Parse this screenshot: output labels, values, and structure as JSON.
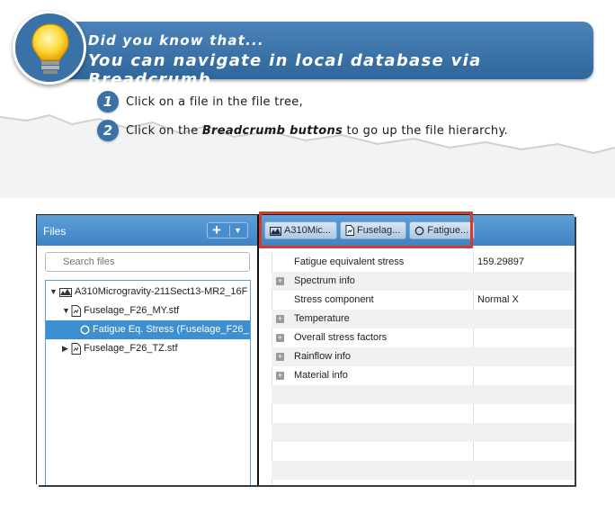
{
  "tip": {
    "line1": "Did you know that...",
    "line2": "You can navigate in local database via Breadcrumb",
    "steps": [
      {
        "num": "1",
        "text": "Click on a file in the file tree,"
      },
      {
        "num": "2",
        "prefix": "Click on the ",
        "bold": "Breadcrumb buttons",
        "suffix": " to go up the file hierarchy."
      }
    ]
  },
  "files_panel": {
    "title": "Files",
    "add_label": "+",
    "search_placeholder": "Search files",
    "tree": [
      {
        "label": "A310Microgravity-211Sect13-MR2_16F",
        "level": 0,
        "twisty": "▼",
        "icon": "folder-icon"
      },
      {
        "label": "Fuselage_F26_MY.stf",
        "level": 1,
        "twisty": "▼",
        "icon": "file-icon"
      },
      {
        "label": "Fatigue Eq. Stress (Fuselage_F26_",
        "level": 2,
        "twisty": "",
        "icon": "circle-icon",
        "selected": true
      },
      {
        "label": "Fuselage_F26_TZ.stf",
        "level": 1,
        "twisty": "▶",
        "icon": "file-icon"
      }
    ]
  },
  "breadcrumb": [
    "A310Mic...",
    "Fuselag...",
    "Fatigue..."
  ],
  "properties": [
    {
      "key": "Fatigue equivalent stress",
      "value": "159.29897",
      "expandable": false
    },
    {
      "key": "Spectrum info",
      "value": "",
      "expandable": true
    },
    {
      "key": "Stress component",
      "value": "Normal X",
      "expandable": false
    },
    {
      "key": "Temperature",
      "value": "",
      "expandable": true
    },
    {
      "key": "Overall stress factors",
      "value": "",
      "expandable": true
    },
    {
      "key": "Rainflow info",
      "value": "",
      "expandable": true
    },
    {
      "key": "Material info",
      "value": "",
      "expandable": true
    }
  ],
  "colors": {
    "banner": "#3a72a8",
    "header": "#4a8dcc",
    "selection": "#3d8fd0",
    "highlight": "#d63a2c"
  }
}
